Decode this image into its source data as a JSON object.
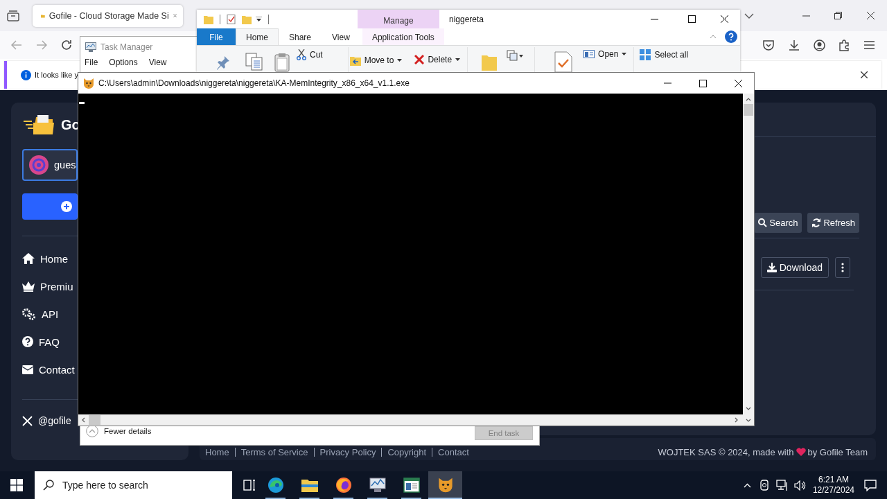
{
  "browser": {
    "tab_title": "Gofile - Cloud Storage Made Si",
    "notification": "It looks like y"
  },
  "gofile": {
    "logo_text": "Go",
    "account": "gues",
    "nav": [
      {
        "label": "Home",
        "kind": "home"
      },
      {
        "label": "Premiu",
        "kind": "premium"
      },
      {
        "label": "API",
        "kind": "api"
      },
      {
        "label": "FAQ",
        "kind": "faq"
      },
      {
        "label": "Contact",
        "kind": "contact"
      }
    ],
    "social": "@gofile",
    "toolbar": [
      {
        "label": "Search",
        "kind": "search"
      },
      {
        "label": "Refresh",
        "kind": "refresh"
      }
    ],
    "download": "Download",
    "footer_links": [
      "Home",
      "Terms of Service",
      "Privacy Policy",
      "Copyright",
      "Contact"
    ],
    "credit_before": "WOJTEK SAS © 2024, made with",
    "credit_after": "by Gofile Team"
  },
  "task_manager": {
    "title": "Task Manager",
    "menu": [
      "File",
      "Options",
      "View"
    ],
    "details_toggle": "Fewer details",
    "end_task": {
      "label": "End task",
      "disabled": true
    }
  },
  "explorer": {
    "title": "niggereta",
    "context_header": "Manage",
    "tabs": [
      {
        "label": "File",
        "kind": "file",
        "selected": false
      },
      {
        "label": "Home",
        "kind": "normal",
        "selected": true
      },
      {
        "label": "Share",
        "kind": "normal",
        "selected": false
      },
      {
        "label": "View",
        "kind": "normal",
        "selected": false
      },
      {
        "label": "Application Tools",
        "kind": "contextual",
        "selected": false
      }
    ],
    "commands": [
      {
        "label": "Cut",
        "dropdown": false
      },
      {
        "label": "Move to",
        "dropdown": true
      },
      {
        "label": "Delete",
        "dropdown": true
      },
      {
        "label": "Open",
        "dropdown": true
      },
      {
        "label": "Select all",
        "dropdown": false
      }
    ]
  },
  "console": {
    "title": "C:\\Users\\admin\\Downloads\\niggereta\\niggereta\\KA-MemIntegrity_x86_x64_v1.1.exe"
  },
  "taskbar": {
    "search_placeholder": "Type here to search",
    "apps": [
      {
        "kind": "edge",
        "selected": false
      },
      {
        "kind": "explorer",
        "selected": false
      },
      {
        "kind": "firefox",
        "selected": false
      },
      {
        "kind": "monitor",
        "selected": false
      },
      {
        "kind": "window",
        "selected": false
      },
      {
        "kind": "console",
        "selected": true
      }
    ],
    "time": "6:21 AM",
    "date": "12/27/2024"
  }
}
